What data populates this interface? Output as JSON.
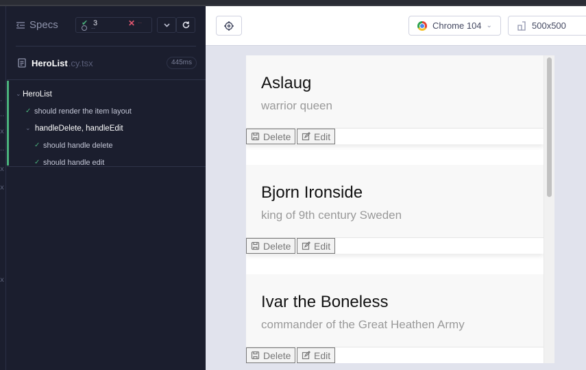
{
  "reporter": {
    "specs_label": "Specs",
    "stats": {
      "passed": "3",
      "pending": "--",
      "failed": "--"
    },
    "spec_file": {
      "name": "HeroList",
      "ext": ".cy.tsx",
      "duration": "445ms"
    },
    "tests": [
      {
        "label": "HeroList",
        "kind": "suite",
        "indent": 0
      },
      {
        "label": "should render the item layout",
        "kind": "test",
        "indent": 1
      },
      {
        "label": "handleDelete, handleEdit",
        "kind": "suite",
        "indent": 1
      },
      {
        "label": "should handle delete",
        "kind": "test",
        "indent": 2
      },
      {
        "label": "should handle edit",
        "kind": "test",
        "indent": 2
      }
    ],
    "rail_marks": [
      ".",
      "..",
      "x",
      "..",
      "x",
      "x",
      "x"
    ]
  },
  "app": {
    "browser_label": "Chrome 104",
    "viewport_label": "500x500",
    "heroes": [
      {
        "name": "Aslaug",
        "description": "warrior queen"
      },
      {
        "name": "Bjorn Ironside",
        "description": "king of 9th century Sweden"
      },
      {
        "name": "Ivar the Boneless",
        "description": "commander of the Great Heathen Army"
      }
    ],
    "delete_label": "Delete",
    "edit_label": "Edit"
  },
  "colors": {
    "reporter_bg": "#1b1e2e",
    "pass": "#4ab27c",
    "fail": "#e45770",
    "app_bg": "#e1e3ed"
  }
}
